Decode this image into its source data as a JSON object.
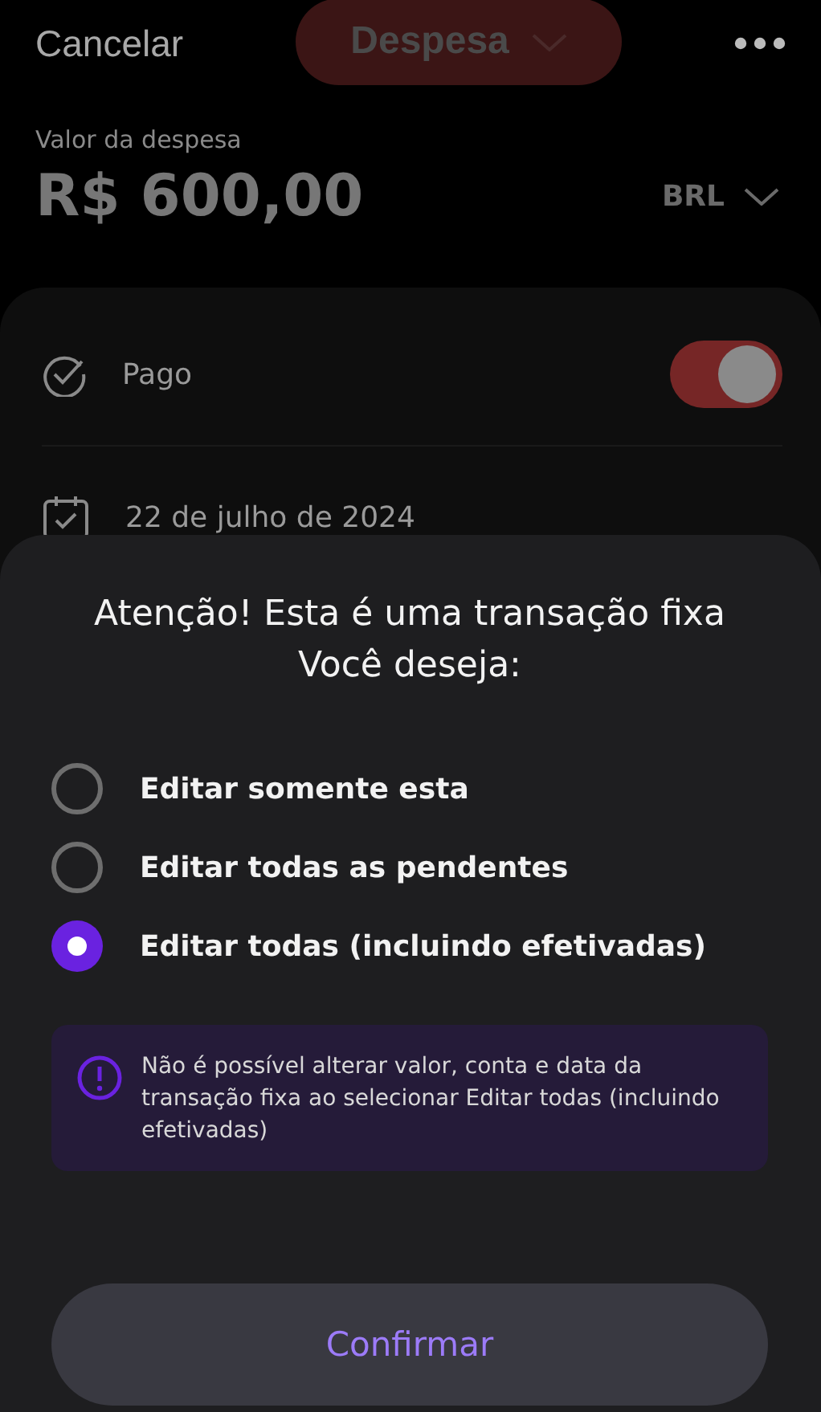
{
  "header": {
    "cancel": "Cancelar",
    "type_selector": "Despesa"
  },
  "amount": {
    "label": "Valor da despesa",
    "value": "R$ 600,00",
    "currency": "BRL"
  },
  "form": {
    "paid": {
      "label": "Pago",
      "on": true
    },
    "date": "22 de julho de 2024"
  },
  "sheet": {
    "title": [
      "Atenção! Esta é uma transação fixa",
      "Você deseja:"
    ],
    "options": [
      {
        "label": "Editar somente esta",
        "selected": false
      },
      {
        "label": "Editar todas as pendentes",
        "selected": false
      },
      {
        "label": "Editar todas (incluindo efetivadas)",
        "selected": true
      }
    ],
    "notice": "Não é possível alterar valor, conta e data da transação fixa ao selecionar Editar todas (incluindo efetivadas)",
    "confirm": "Confirmar"
  }
}
